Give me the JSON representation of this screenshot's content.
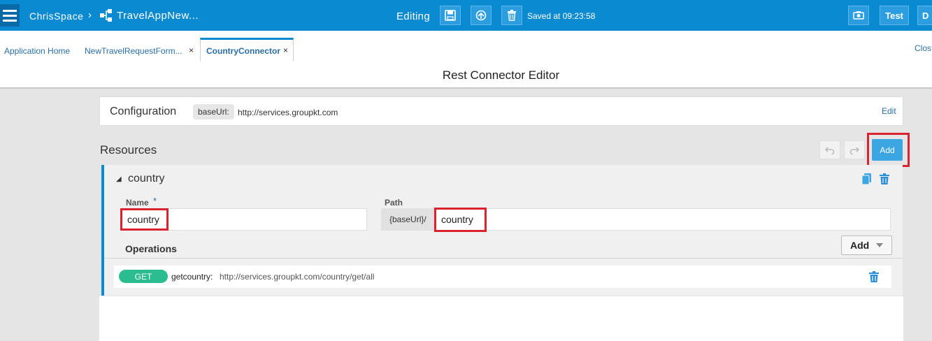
{
  "topbar": {
    "space": "ChrisSpace",
    "separator": "›",
    "app": "TravelAppNew...",
    "mode": "Editing",
    "saved": "Saved at 09:23:58",
    "test_label": "Test",
    "d_label": "D"
  },
  "tabs": {
    "items": [
      {
        "label": "Application Home"
      },
      {
        "label": "NewTravelRequestForm..."
      },
      {
        "label": "CountryConnector"
      }
    ],
    "close_glyph": "×",
    "close_all": "Clos"
  },
  "editor": {
    "title": "Rest Connector Editor"
  },
  "configuration": {
    "label": "Configuration",
    "baseurl_key": "baseUrl:",
    "baseurl_value": "http://services.groupkt.com",
    "edit_label": "Edit"
  },
  "resources": {
    "title": "Resources",
    "add_label": "Add",
    "resource": {
      "name": "country",
      "toggle_glyph": "◢",
      "name_label": "Name",
      "required_star": "*",
      "name_value": "country",
      "path_label": "Path",
      "path_prefix": "{baseUrl}/",
      "path_value": "country",
      "operations_label": "Operations",
      "operations_add_label": "Add",
      "operations": [
        {
          "method": "GET",
          "name": "getcountry:",
          "url": "http://services.groupkt.com/country/get/all"
        }
      ]
    }
  },
  "colors": {
    "topbar": "#0a8ad1",
    "accent_link": "#2a6ea6",
    "highlight_red": "#d9232e",
    "get_badge": "#2bbc8f"
  }
}
